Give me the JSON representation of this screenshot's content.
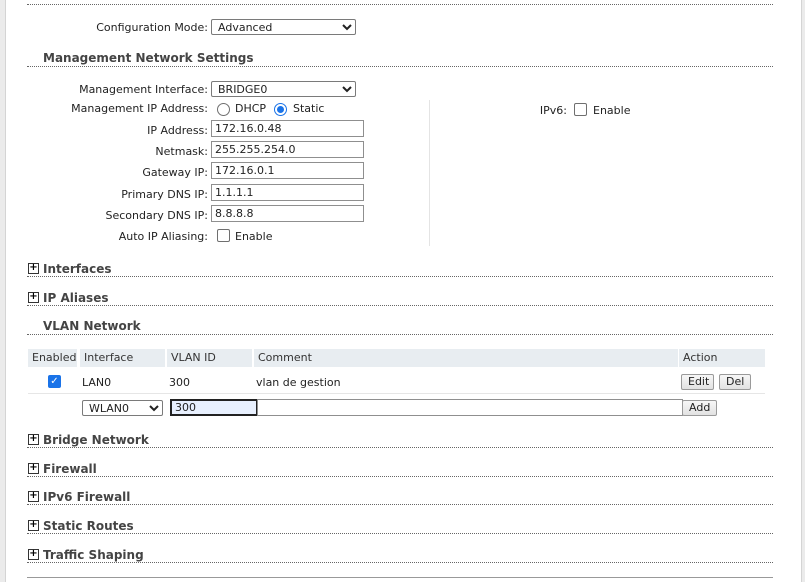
{
  "config_mode": {
    "label": "Configuration Mode:",
    "value": "Advanced"
  },
  "mgmt": {
    "title": "Management Network Settings",
    "interface_label": "Management Interface:",
    "interface_value": "BRIDGE0",
    "ipaddr_mode_label": "Management IP Address:",
    "dhcp_label": "DHCP",
    "static_label": "Static",
    "ip_label": "IP Address:",
    "ip_value": "172.16.0.48",
    "netmask_label": "Netmask:",
    "netmask_value": "255.255.254.0",
    "gateway_label": "Gateway IP:",
    "gateway_value": "172.16.0.1",
    "pdns_label": "Primary DNS IP:",
    "pdns_value": "1.1.1.1",
    "sdns_label": "Secondary DNS IP:",
    "sdns_value": "8.8.8.8",
    "alias_label": "Auto IP Aliasing:",
    "alias_enable": "Enable",
    "ipv6_label": "IPv6:",
    "ipv6_enable": "Enable"
  },
  "sections": {
    "interfaces": "Interfaces",
    "ip_aliases": "IP Aliases",
    "vlan": "VLAN Network",
    "bridge": "Bridge Network",
    "firewall": "Firewall",
    "ipv6_firewall": "IPv6 Firewall",
    "static_routes": "Static Routes",
    "traffic_shaping": "Traffic Shaping"
  },
  "vlan_table": {
    "headers": {
      "enabled": "Enabled",
      "interface": "Interface",
      "vlan_id": "VLAN ID",
      "comment": "Comment",
      "action": "Action"
    },
    "rows": [
      {
        "enabled": true,
        "interface": "LAN0",
        "vlan_id": "300",
        "comment": "vlan de gestion",
        "edit": "Edit",
        "del": "Del"
      }
    ],
    "new_row": {
      "interface": "WLAN0",
      "vlan_id": "300",
      "comment": "",
      "add": "Add"
    }
  },
  "colors": {
    "accent": "#1a73e8",
    "header_bg": "#e8edf1"
  }
}
